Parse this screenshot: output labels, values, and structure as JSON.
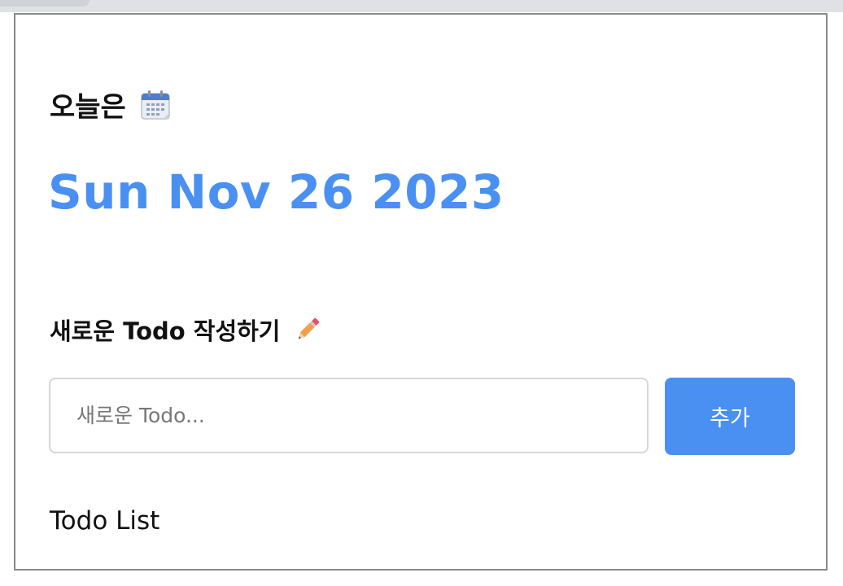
{
  "header": {
    "today_label": "오늘은",
    "date": "Sun Nov 26 2023"
  },
  "editor": {
    "title": "새로운 Todo 작성하기",
    "input_value": "",
    "input_placeholder": "새로운 Todo...",
    "add_button_label": "추가"
  },
  "list": {
    "heading": "Todo List"
  },
  "colors": {
    "accent": "#4a90f2",
    "input_border": "#d7d7d7",
    "frame_border": "#8a8a8a"
  },
  "icons": {
    "calendar": "calendar-icon",
    "pencil": "pencil-icon"
  }
}
